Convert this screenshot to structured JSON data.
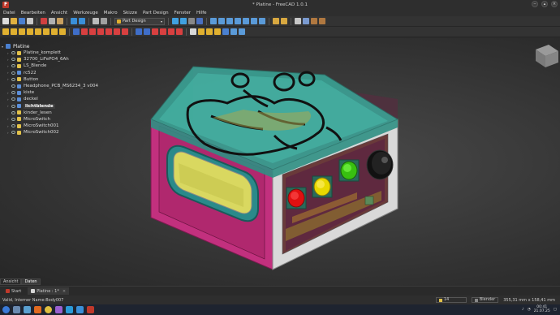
{
  "window": {
    "title": "* Platine - FreeCAD 1.0.1",
    "app_icon": "F",
    "controls": [
      "minimize",
      "maximize",
      "close"
    ]
  },
  "menu": [
    "Datei",
    "Bearbeiten",
    "Ansicht",
    "Werkzeuge",
    "Makro",
    "Skizze",
    "Part Design",
    "Fenster",
    "Hilfe"
  ],
  "toolbar": {
    "workbench": "Part Design"
  },
  "tree": {
    "root": "Platine",
    "items": [
      {
        "label": "Platine_komplett",
        "icon": "yellow",
        "expandable": true
      },
      {
        "label": "32700_LiFePO4_6Ah",
        "icon": "yellow",
        "expandable": true
      },
      {
        "label": "LS_Blende",
        "icon": "yellow",
        "expandable": true
      },
      {
        "label": "rc522",
        "icon": "blue",
        "expandable": true
      },
      {
        "label": "Button",
        "icon": "yellow",
        "expandable": true
      },
      {
        "label": "Headphone_PCB_MS6234_3 v004",
        "icon": "blue",
        "expandable": false
      },
      {
        "label": "kiste",
        "icon": "blue",
        "expandable": true
      },
      {
        "label": "deckel",
        "icon": "blue",
        "expandable": true
      },
      {
        "label": "lichtblende",
        "icon": "blue",
        "expandable": true,
        "selected": true
      },
      {
        "label": "kinder_lesen",
        "icon": "yellow",
        "expandable": false
      },
      {
        "label": "MicroSwitch",
        "icon": "yellow",
        "expandable": true
      },
      {
        "label": "MicroSwitch001",
        "icon": "yellow",
        "expandable": true
      },
      {
        "label": "MicroSwitch002",
        "icon": "yellow",
        "expandable": true
      }
    ]
  },
  "panel_tabs": [
    "Ansicht",
    "Daten"
  ],
  "doc_tabs": [
    {
      "label": "Start",
      "icon": "freecad",
      "active": false
    },
    {
      "label": "Platine : 1*",
      "icon": "doc",
      "active": true,
      "close": "×"
    }
  ],
  "status": {
    "message": "Valid, Interner Name:Body007",
    "count": "14",
    "navigation": "Blender",
    "dimensions": "355,31 mm x 158,41 mm",
    "time": "00:41",
    "date": "21.07.25"
  },
  "colors": {
    "box_magenta": "#c2307e",
    "lid_teal": "#3aa89a",
    "panel_white": "#d9d9d9",
    "btn_red": "#e01010",
    "btn_yellow": "#e8d800",
    "btn_green": "#38c010",
    "window_yellow": "#d9d860"
  }
}
